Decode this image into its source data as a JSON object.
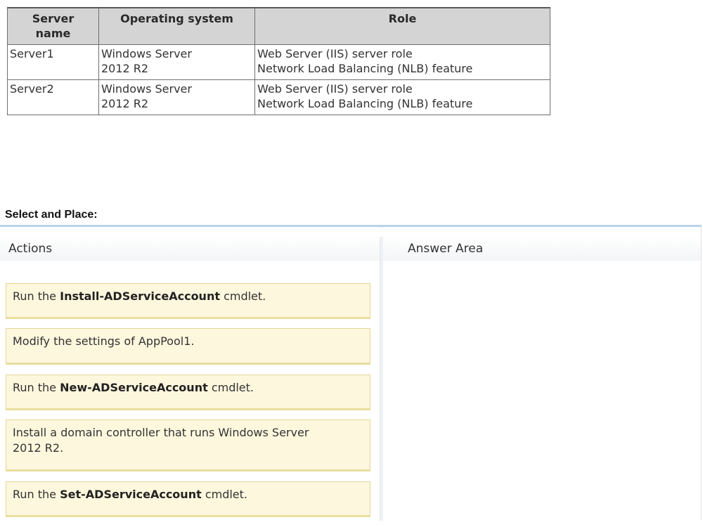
{
  "server_table": {
    "headers": {
      "name_line1": "Server",
      "name_line2": "name",
      "os": "Operating system",
      "role": "Role"
    },
    "rows": [
      {
        "name": "Server1",
        "os_line1": "Windows Server",
        "os_line2": "2012 R2",
        "role_line1": "Web Server (IIS) server role",
        "role_line2": "Network Load Balancing (NLB) feature"
      },
      {
        "name": "Server2",
        "os_line1": "Windows Server",
        "os_line2": "2012 R2",
        "role_line1": "Web Server (IIS) server role",
        "role_line2": "Network Load Balancing (NLB) feature"
      }
    ]
  },
  "select_and_place": "Select and Place:",
  "actions_panel": {
    "header": "Actions",
    "items": [
      {
        "prefix": "Run the ",
        "bold": "Install-ADServiceAccount",
        "suffix": " cmdlet."
      },
      {
        "text": "Modify the settings of AppPool1."
      },
      {
        "prefix": "Run the ",
        "bold": "New-ADServiceAccount",
        "suffix": " cmdlet."
      },
      {
        "line1": "Install a domain controller that runs Windows Server",
        "line2": "2012 R2."
      },
      {
        "prefix": "Run the ",
        "bold": "Set-ADServiceAccount",
        "suffix": " cmdlet."
      }
    ]
  },
  "answer_panel": {
    "header": "Answer Area"
  },
  "colors": {
    "item_background": "#fdf7dd",
    "item_border": "#e3d79a",
    "table_header_background": "#d4d4d4",
    "panel_accent": "#b9d3ea"
  }
}
